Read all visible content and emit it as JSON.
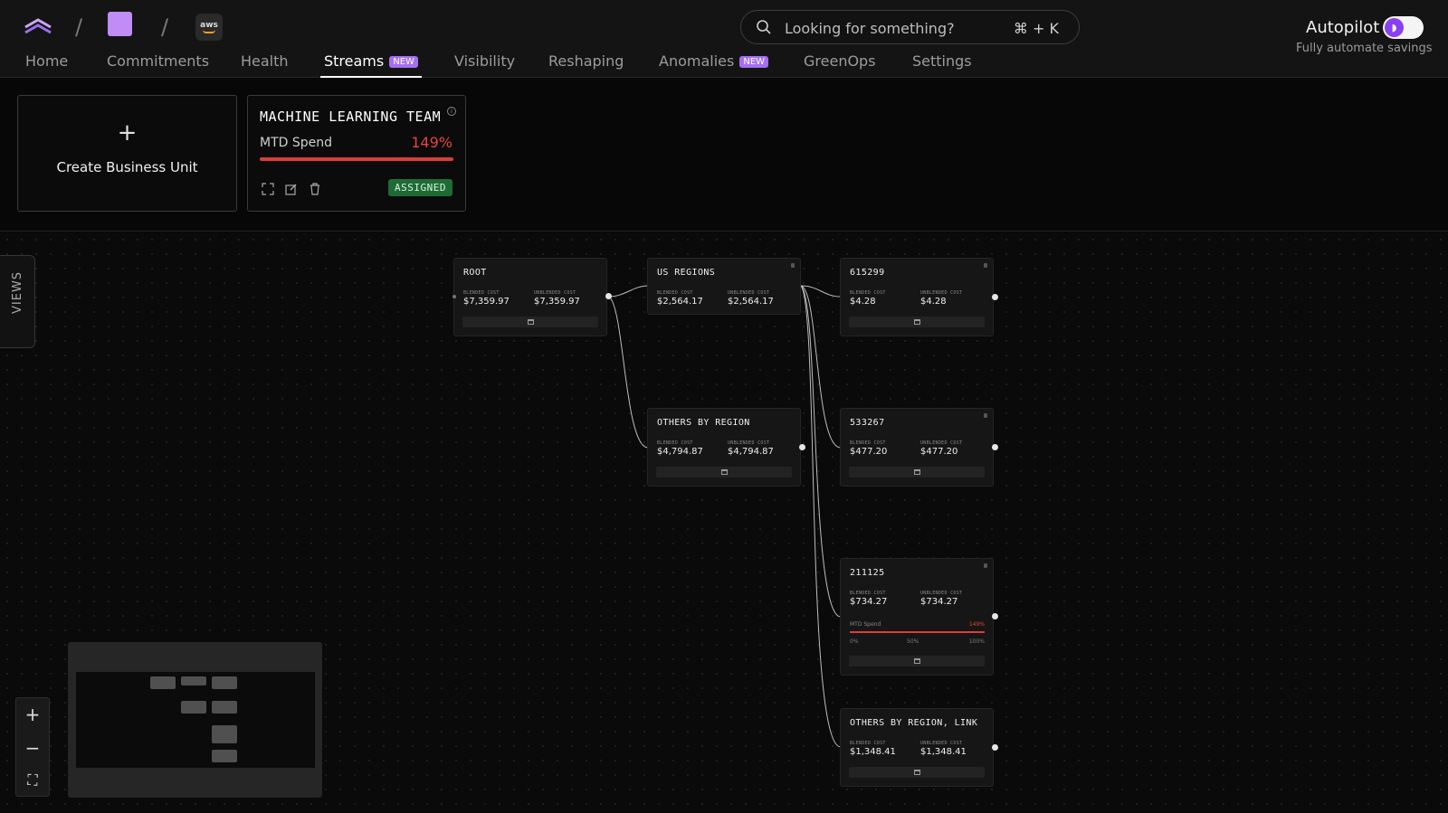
{
  "header": {
    "crumb_separator": "/",
    "provider_badge": "aws",
    "search_placeholder": "Looking for something?",
    "search_shortcut": "⌘ + K",
    "autopilot_label": "Autopilot",
    "autopilot_sub": "Fully automate savings",
    "autopilot_enabled": true
  },
  "nav": {
    "items": [
      {
        "label": "Home"
      },
      {
        "label": "Commitments"
      },
      {
        "label": "Health"
      },
      {
        "label": "Streams",
        "badge": "NEW",
        "active": true
      },
      {
        "label": "Visibility"
      },
      {
        "label": "Reshaping"
      },
      {
        "label": "Anomalies",
        "badge": "NEW"
      },
      {
        "label": "GreenOps"
      },
      {
        "label": "Settings"
      }
    ]
  },
  "business_units": {
    "create_plus": "+",
    "create_label": "Create Business Unit",
    "card": {
      "name": "MACHINE LEARNING TEAM",
      "mtd_label": "MTD Spend",
      "mtd_percent": "149%",
      "status": "ASSIGNED",
      "colors": {
        "accent": "#e03c36",
        "assigned": "#1f6b35"
      }
    }
  },
  "canvas": {
    "views_tab": "VIEWS",
    "cost_labels": {
      "blended": "BLENDED COST",
      "unblended": "UNBLENDED COST"
    },
    "nodes": {
      "root": {
        "title": "ROOT",
        "blended": "$7,359.97",
        "unblended": "$7,359.97"
      },
      "us_regions": {
        "title": "US REGIONS",
        "blended": "$2,564.17",
        "unblended": "$2,564.17"
      },
      "others_by_region": {
        "title": "OTHERS BY REGION",
        "blended": "$4,794.87",
        "unblended": "$4,794.87"
      },
      "n615299": {
        "title": "615299",
        "blended": "$4.28",
        "unblended": "$4.28"
      },
      "n533267": {
        "title": "533267",
        "blended": "$477.20",
        "unblended": "$477.20"
      },
      "n211125": {
        "title": "211125",
        "blended": "$734.27",
        "unblended": "$734.27",
        "mtd_label": "MTD Spend",
        "mtd_percent": "149%",
        "ticks": [
          "0%",
          "50%",
          "100%"
        ]
      },
      "others_link": {
        "title": "OTHERS BY REGION, LINK",
        "blended": "$1,348.41",
        "unblended": "$1,348.41"
      }
    },
    "zoom": {
      "in": "+",
      "out": "−",
      "fit": "⛶"
    }
  }
}
